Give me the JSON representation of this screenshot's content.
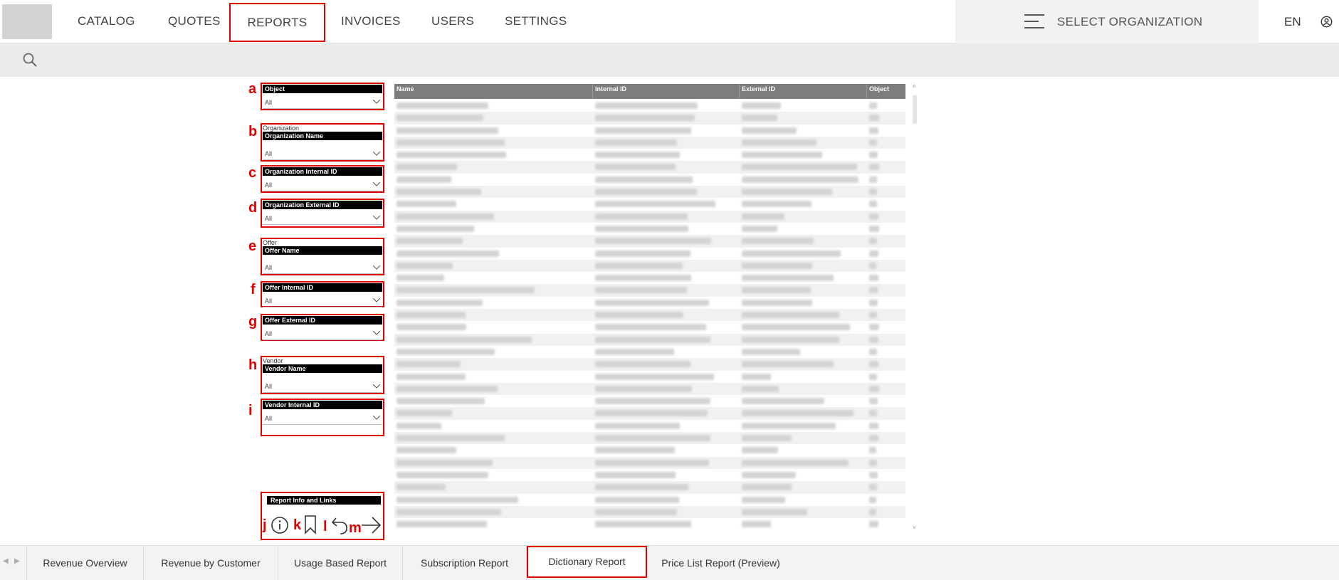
{
  "nav": {
    "items": [
      "CATALOG",
      "QUOTES",
      "REPORTS",
      "INVOICES",
      "USERS",
      "SETTINGS"
    ],
    "active": "REPORTS",
    "org_label": "SELECT ORGANIZATION",
    "language": "EN"
  },
  "filters": [
    {
      "marker": "a",
      "group": "",
      "header": "Object",
      "value": "All"
    },
    {
      "marker": "b",
      "group": "Organization",
      "header": "Organization Name",
      "value": "All"
    },
    {
      "marker": "c",
      "group": "",
      "header": "Organization Internal ID",
      "value": "All"
    },
    {
      "marker": "d",
      "group": "",
      "header": "Organization External ID",
      "value": "All"
    },
    {
      "marker": "e",
      "group": "Offer",
      "header": "Offer Name",
      "value": "All"
    },
    {
      "marker": "f",
      "group": "",
      "header": "Offer Internal ID",
      "value": "All"
    },
    {
      "marker": "g",
      "group": "",
      "header": "Offer External ID",
      "value": "All"
    },
    {
      "marker": "h",
      "group": "Vendor",
      "header": "Vendor Name",
      "value": "All"
    },
    {
      "marker": "i",
      "group": "",
      "header": "Vendor Internal ID",
      "value": "All"
    }
  ],
  "info": {
    "header": "Report Info and Links",
    "markers": [
      "j",
      "k",
      "l",
      "m"
    ]
  },
  "table": {
    "columns": [
      "Name",
      "Internal ID",
      "External ID",
      "Object"
    ]
  },
  "tabs": [
    "Revenue Overview",
    "Revenue by Customer",
    "Usage Based Report",
    "Subscription Report",
    "Dictionary Report",
    "Price List Report (Preview)"
  ],
  "active_tab": "Dictionary Report",
  "colors": {
    "highlight": "#e00000",
    "header_bg": "#7d7d7d"
  }
}
